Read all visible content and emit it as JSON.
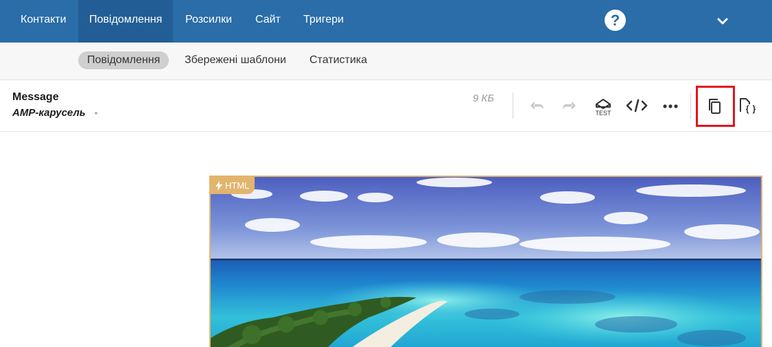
{
  "topnav": {
    "items": [
      {
        "label": "Контакти"
      },
      {
        "label": "Повідомлення"
      },
      {
        "label": "Розсилки"
      },
      {
        "label": "Сайт"
      },
      {
        "label": "Тригери"
      }
    ],
    "active_index": 1,
    "help_label": "?",
    "account_icon": "chevron-down-icon"
  },
  "subnav": {
    "tabs": [
      {
        "label": "Повідомлення"
      },
      {
        "label": "Збережені шаблони"
      },
      {
        "label": "Статистика"
      }
    ],
    "active_index": 0
  },
  "toolbar": {
    "type_label": "Message",
    "message_name": "AMP-карусель",
    "size": "9 КБ",
    "test_label": "TEST",
    "icons": [
      "undo-icon",
      "redo-icon",
      "send-test-icon",
      "code-icon",
      "more-icon",
      "copy-icon",
      "json-file-icon"
    ],
    "highlighted_icon": "copy-icon"
  },
  "preview": {
    "badge": "HTML",
    "badge_icon": "lightning-icon",
    "image": "tropical-beach-photo"
  },
  "colors": {
    "nav_bg": "#2a6da8",
    "nav_active_bg": "#225e95",
    "badge_border": "#e2b46e",
    "highlight": "#e5141b"
  }
}
